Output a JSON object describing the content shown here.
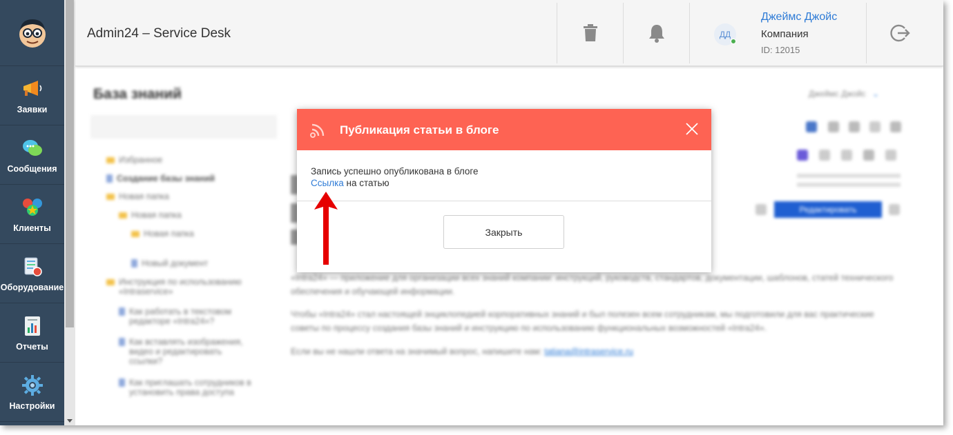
{
  "header": {
    "title": "Admin24 – Service Desk",
    "user": {
      "initials": "ДД",
      "name": "Джеймс Джойс",
      "company": "Компания",
      "id_label": "ID: 12015"
    }
  },
  "sidebar": {
    "items": [
      {
        "label": "Заявки",
        "icon": "megaphone-icon"
      },
      {
        "label": "Сообщения",
        "icon": "chat-bubbles-icon"
      },
      {
        "label": "Клиенты",
        "icon": "clients-icon"
      },
      {
        "label": "Оборудование",
        "icon": "equipment-icon"
      },
      {
        "label": "Отчеты",
        "icon": "report-chart-icon"
      },
      {
        "label": "Настройки",
        "icon": "gear-icon"
      }
    ]
  },
  "background": {
    "heading": "База знаний",
    "tree": [
      "Избранное",
      "Создание базы знаний",
      "Новая папка",
      "Новая папка",
      "Новая папка",
      "Новый документ",
      "Инструкция по использованию «Intraservice»",
      "Как работать в текстовом редакторе «Intra24»?",
      "Как вставлять изображения, видео и редактировать ссылки?",
      "Как приглашать сотрудников в установить права доступа"
    ],
    "paragraphs": [
      "«Intra24» — приложение для организации всех знаний компании: инструкций, руководств, стандартов, документации, шаблонов, статей технического обеспечения и обучающей информации.",
      "Чтобы «Intra24» стал настоящей энциклопедией корпоративных знаний и был полезен всем сотрудникам, мы подготовили для вас практические советы по процессу создания базы знаний и инструкцию по использованию функциональных возможностей «Intra24».",
      "Если вы не нашли ответа на значимый вопрос, напишите нам: "
    ],
    "email": "tatiana@intraservice.ru",
    "edit_button": "Редактировать",
    "author": "Джеймс Джойс"
  },
  "modal": {
    "title": "Публикация статьи в блоге",
    "message": "Запись успешно опубликована в блоге",
    "link_text": "Ссылка",
    "link_suffix": " на статью",
    "close_button": "Закрыть"
  },
  "colors": {
    "sidebar": "#34495e",
    "modal_header": "#fe6353",
    "accent_link": "#2e7bd6",
    "annotation_arrow": "#e60000"
  }
}
